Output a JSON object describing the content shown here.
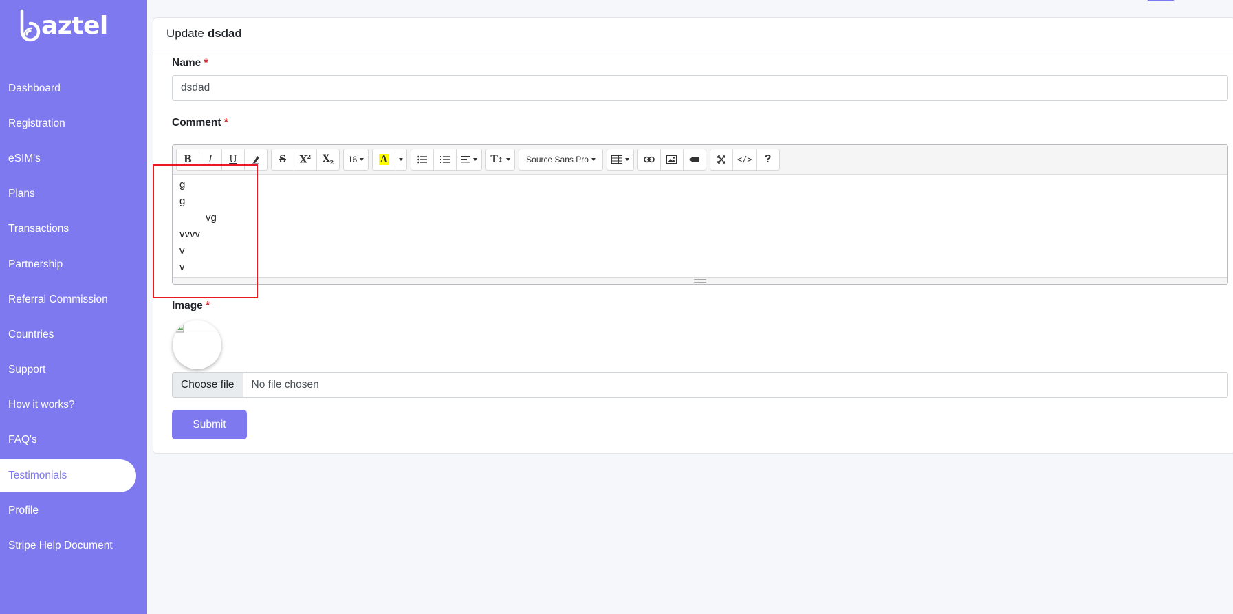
{
  "app": {
    "logo_text": "aztel",
    "brand_color": "#7f79f0"
  },
  "sidebar": {
    "items": [
      {
        "label": "Dashboard",
        "active": false
      },
      {
        "label": "Registration",
        "active": false
      },
      {
        "label": "eSIM's",
        "active": false
      },
      {
        "label": "Plans",
        "active": false
      },
      {
        "label": "Transactions",
        "active": false
      },
      {
        "label": "Partnership",
        "active": false
      },
      {
        "label": "Referral Commission",
        "active": false
      },
      {
        "label": "Countries",
        "active": false
      },
      {
        "label": "Support",
        "active": false
      },
      {
        "label": "How it works?",
        "active": false
      },
      {
        "label": "FAQ's",
        "active": false
      },
      {
        "label": "Testimonials",
        "active": true
      },
      {
        "label": "Profile",
        "active": false
      },
      {
        "label": "Stripe Help Document",
        "active": false
      }
    ]
  },
  "form": {
    "header_prefix": "Update",
    "header_name": "dsdad",
    "required_mark": "*",
    "name_label": "Name",
    "name_value": "dsdad",
    "comment_label": "Comment",
    "editor": {
      "font_size": "16",
      "font_family": "Source Sans Pro",
      "lines": [
        "g",
        "g",
        "vg",
        "vvvv",
        "v",
        "v"
      ]
    },
    "image_label": "Image",
    "file_button": "Choose file",
    "file_status": "No file chosen",
    "submit_label": "Submit"
  }
}
